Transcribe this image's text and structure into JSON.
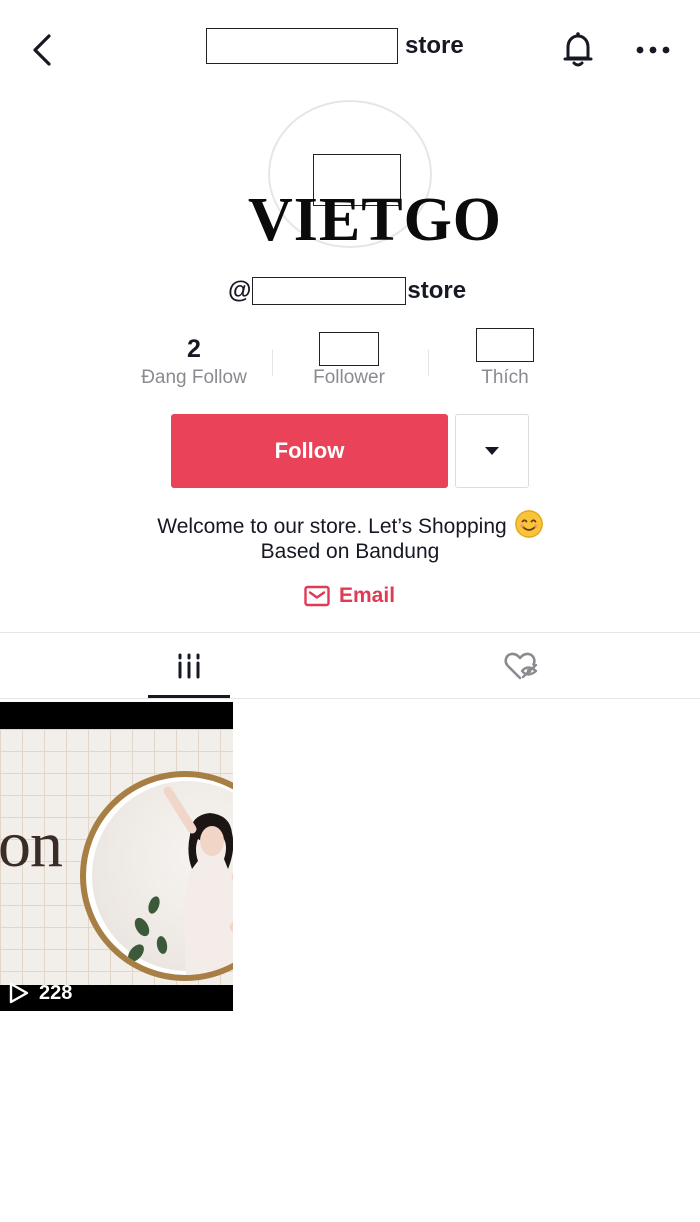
{
  "header": {
    "title_suffix": "store",
    "icons": {
      "back": "chevron-left-icon",
      "bell": "bell-icon",
      "more": "more-horizontal-icon"
    }
  },
  "profile": {
    "avatar_text": "VIETGO",
    "handle_prefix": "@",
    "handle_suffix": "store"
  },
  "stats": [
    {
      "value": "2",
      "label": "Đang Follow"
    },
    {
      "value": "",
      "label": "Follower"
    },
    {
      "value": "",
      "label": "Thích"
    }
  ],
  "actions": {
    "follow_label": "Follow",
    "dropdown_icon": "caret-down-icon"
  },
  "bio": {
    "line1": "Welcome to our store. Let’s Shopping",
    "emoji": "smiling-face-emoji",
    "line2": "Based on Bandung"
  },
  "email": {
    "label": "Email",
    "icon": "mail-icon"
  },
  "tabs": [
    {
      "name": "videos",
      "icon": "grid-lines-icon",
      "active": true
    },
    {
      "name": "liked",
      "icon": "heart-eye-off-icon",
      "active": false
    }
  ],
  "videos": [
    {
      "thumb_text": "on",
      "views": "228",
      "icon": "play-outline-icon"
    }
  ],
  "colors": {
    "follow_red": "#ea4359",
    "email_red": "#e03a55",
    "text_dark": "#161823",
    "text_muted": "#8a8b91"
  }
}
